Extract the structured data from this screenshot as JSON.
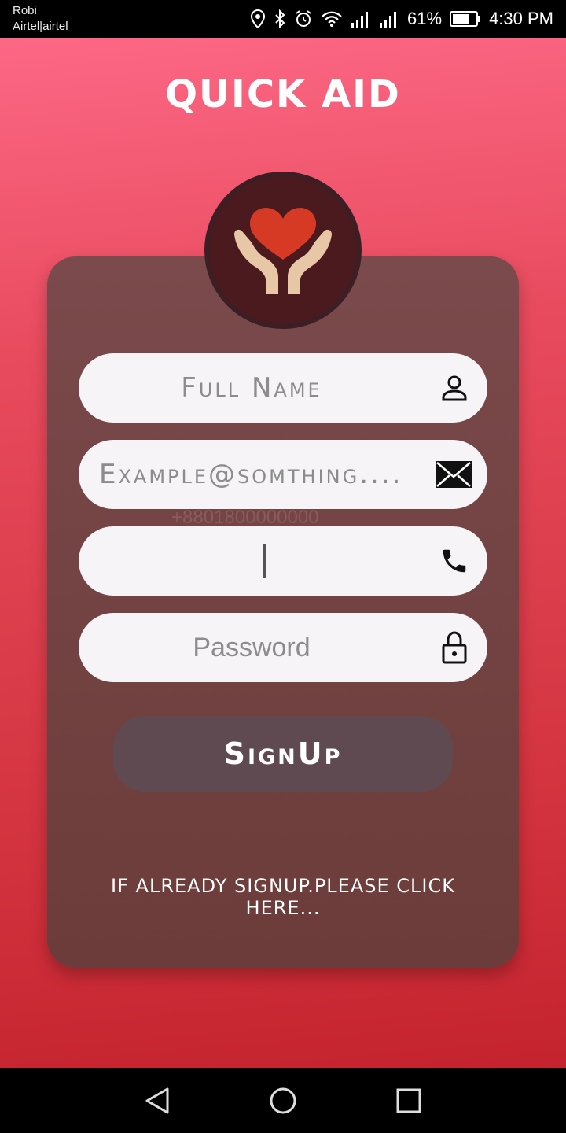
{
  "status_bar": {
    "carrier_line1": "Robi",
    "carrier_line2": "Airtel|airtel",
    "battery_percent": "61%",
    "time": "4:30 PM",
    "icons": [
      "location-icon",
      "bluetooth-icon",
      "alarm-icon",
      "wifi-icon",
      "signal-icon",
      "signal-icon",
      "battery-icon"
    ]
  },
  "app": {
    "title": "QUICK AID",
    "logo_icon": "heart-hands-icon"
  },
  "form": {
    "full_name": {
      "placeholder": "Full Name",
      "icon": "person-icon"
    },
    "email": {
      "placeholder": "Example@somthing....",
      "icon": "mail-icon"
    },
    "phone": {
      "hint": "+8801800000000",
      "value": "",
      "icon": "phone-icon"
    },
    "password": {
      "placeholder": "Password",
      "icon": "lock-icon"
    },
    "signup_label": "SignUp",
    "login_prompt": "IF ALREADY SIGNUP.PLEASE CLICK HERE..."
  },
  "colors": {
    "background_top": "#ff6b8a",
    "background_bottom": "#c1202a",
    "card": "#6c3c3a",
    "button": "#604a52",
    "field": "#f6f4f6",
    "heart": "#d63a24"
  },
  "nav_bar": {
    "icons": [
      "back-icon",
      "home-icon",
      "recents-icon"
    ]
  }
}
